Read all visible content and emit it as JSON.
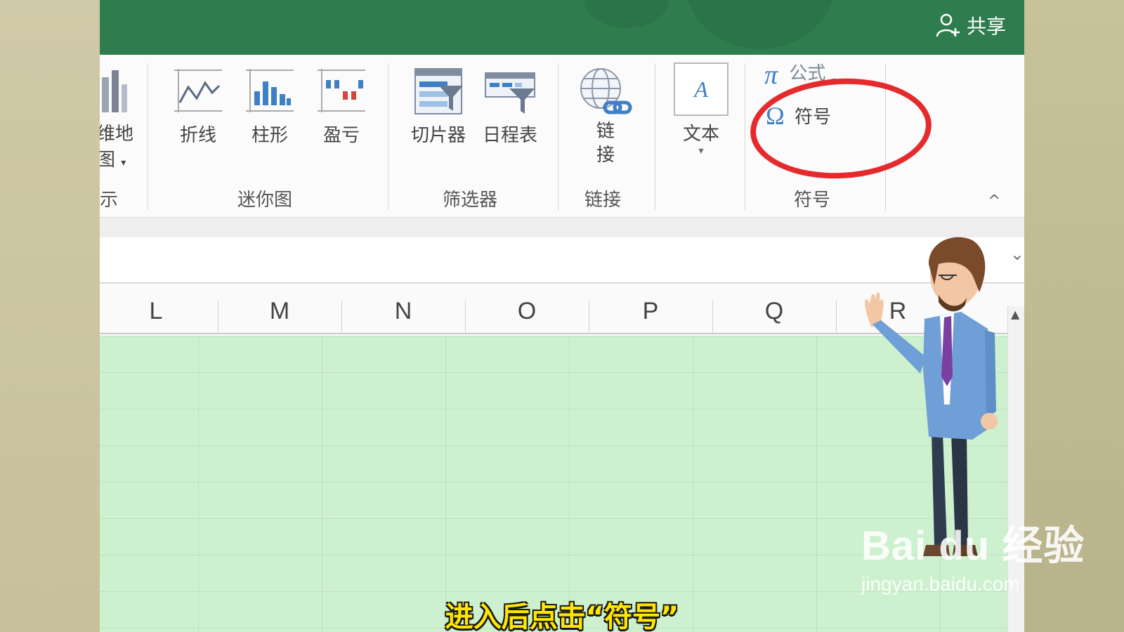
{
  "titlebar": {
    "share_label": "共享"
  },
  "ribbon": {
    "partial_map_label_top": "维地",
    "partial_map_label_bottom": "图",
    "partial_group_label": "示",
    "sparklines": {
      "line": "折线",
      "column": "柱形",
      "winloss": "盈亏",
      "group": "迷你图"
    },
    "filters": {
      "slicer": "切片器",
      "timeline": "日程表",
      "group": "筛选器"
    },
    "links": {
      "link_top": "链",
      "link_bottom": "接",
      "group": "链接"
    },
    "text": {
      "label": "文本"
    },
    "symbols": {
      "formula": "公式",
      "symbol": "符号",
      "group": "符号"
    }
  },
  "columns": [
    "L",
    "M",
    "N",
    "O",
    "P",
    "Q",
    "R"
  ],
  "watermark": {
    "logo_text": "Bai du 经验",
    "url": "jingyan.baidu.com"
  },
  "subtitle": "进入后点击“符号”",
  "colors": {
    "excel_green": "#2f7d4f",
    "grid_green": "#cdf1cf",
    "highlight_red": "#e52a2e",
    "subtitle_yellow": "#ffe600"
  }
}
